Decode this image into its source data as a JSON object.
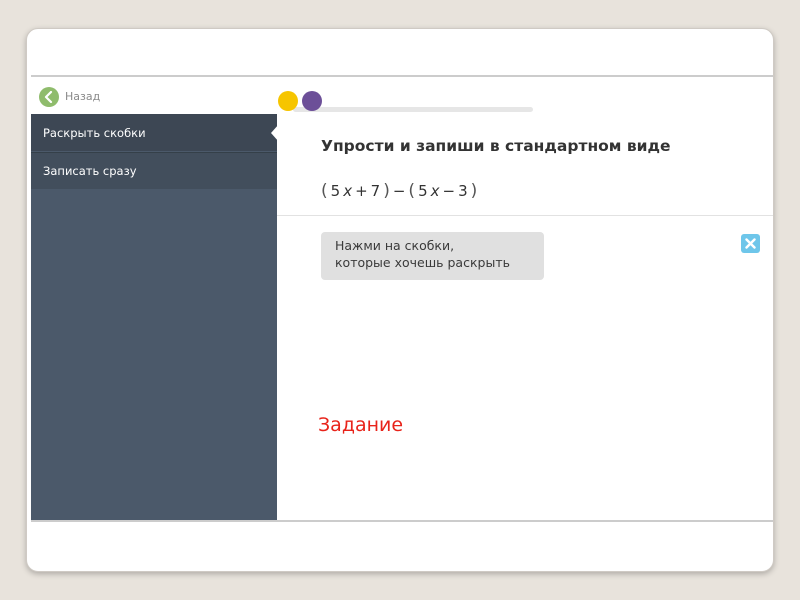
{
  "sidebar": {
    "back_label": "Назад",
    "items": [
      {
        "label": "Раскрыть скобки"
      },
      {
        "label": "Записать сразу"
      }
    ]
  },
  "task": {
    "title": "Упрости и запиши в стандартном виде",
    "expression": {
      "open1": "(",
      "term1_coef": "5",
      "term1_var": "x",
      "plus": "+",
      "term1_const": "7",
      "close1": ")",
      "minus": "−",
      "open2": "(",
      "term2_coef": "5",
      "term2_var": "x",
      "minus2": "−",
      "term2_const": "3",
      "close2": ")"
    }
  },
  "hint": {
    "line1": "Нажми на скобки,",
    "line2": "которые хочешь раскрыть"
  },
  "note": "Задание",
  "colors": {
    "sidebar": "#4b596a",
    "nav_active": "#3d4754",
    "dot_yellow": "#f6c500",
    "dot_purple": "#6c4f98",
    "close_button": "#6ec6ea",
    "note_red": "#e8231a",
    "back_green": "#8fbc6c"
  },
  "icons": {
    "back": "chevron-left-icon",
    "close": "close-icon"
  }
}
